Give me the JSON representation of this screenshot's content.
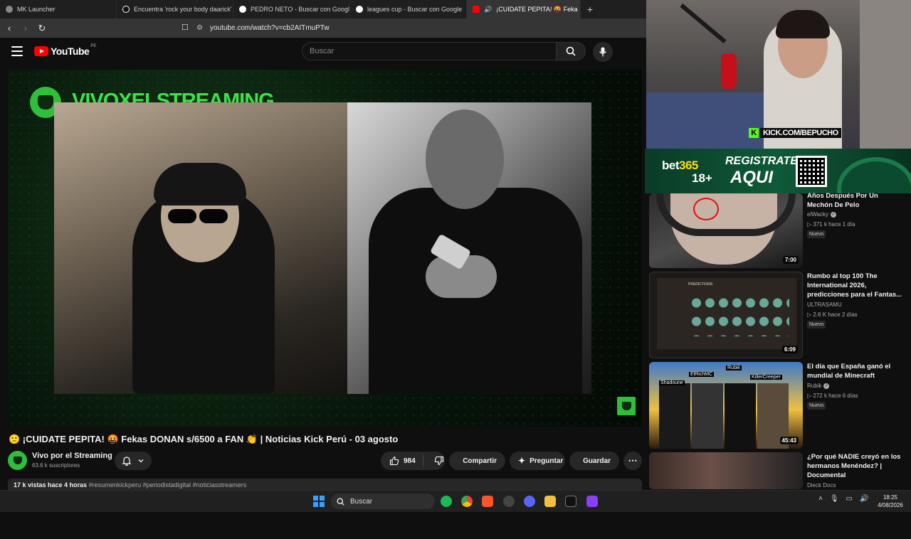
{
  "browser": {
    "tabs": [
      {
        "label": "MK Launcher",
        "active": false
      },
      {
        "label": "Encuentra 'rock your body daarick' en",
        "active": false
      },
      {
        "label": "PEDRO NETO - Buscar con Google",
        "active": false
      },
      {
        "label": "leagues cup - Buscar con Google",
        "active": false
      },
      {
        "label": "¡CUIDATE PEPITA! 🤬 Feka",
        "active": true
      }
    ],
    "new_tab": "+",
    "url": "youtube.com/watch?v=cb2AITmuPTw"
  },
  "youtube": {
    "logo_text": "YouTube",
    "region": "PE",
    "search_placeholder": "Buscar"
  },
  "video": {
    "overlay_title": "VIVOXELSTREAMING",
    "title": "🙁 ¡CUIDATE PEPITA! 🤬 Fekas DONAN s/6500 a FAN 👏 | Noticias Kick Perú - 03 agosto",
    "channel_name": "Vivo por el Streaming",
    "subscribers": "63.6 k suscriptores",
    "likes": "984",
    "share_label": "Compartir",
    "ask_label": "Preguntar",
    "save_label": "Guardar",
    "views_time": "17 k vistas  hace 4 horas",
    "hashtags": "#resumenkickperu #periodistadigital #noticiasstreamers"
  },
  "webcam": {
    "kick_url": "KICK.COM/BEPUCHO"
  },
  "banner": {
    "brand": "bet",
    "brand_num": "365",
    "age": "18+",
    "cta_line1": "REGISTRATE",
    "cta_line2": "AQUI"
  },
  "recommendations": [
    {
      "title": "Años Después Por Un Mechón De Pelo",
      "channel": "elWacky",
      "verified": true,
      "meta": "▷ 371 k  hace 1 día",
      "badge": "Nuevo",
      "duration": "7:00"
    },
    {
      "title": "Rumbo al top 100 The International 2026, predicciones para el Fantas...",
      "channel": "ULTRASAMU",
      "verified": false,
      "meta": "▷ 2.6 K  hace 2 días",
      "badge": "Nuevo",
      "duration": "6:09"
    },
    {
      "title": "El día que España ganó el mundial de Minecraft",
      "channel": "Rubik",
      "verified": true,
      "meta": "▷ 272 k  hace 6 días",
      "badge": "Nuevo",
      "duration": "45:43"
    },
    {
      "title": "¿Por qué NADIE creyó en los hermanos Menéndez? | Documental",
      "channel": "Dieck Docs",
      "verified": false,
      "meta": "",
      "badge": "",
      "duration": ""
    }
  ],
  "thumb_labels": {
    "minecraft_1": "Rubik",
    "minecraft_2": "ElRichMC",
    "minecraft_3": "Shadoune",
    "minecraft_4": "KillerCreeper",
    "dota_header": "PREDICTIONS"
  },
  "taskbar": {
    "search_label": "Buscar",
    "time": "18:25",
    "date": "4/08/2026"
  },
  "colors": {
    "accent_green": "#3ee04a",
    "youtube_red": "#ff0000",
    "kick_green": "#53fc18"
  }
}
